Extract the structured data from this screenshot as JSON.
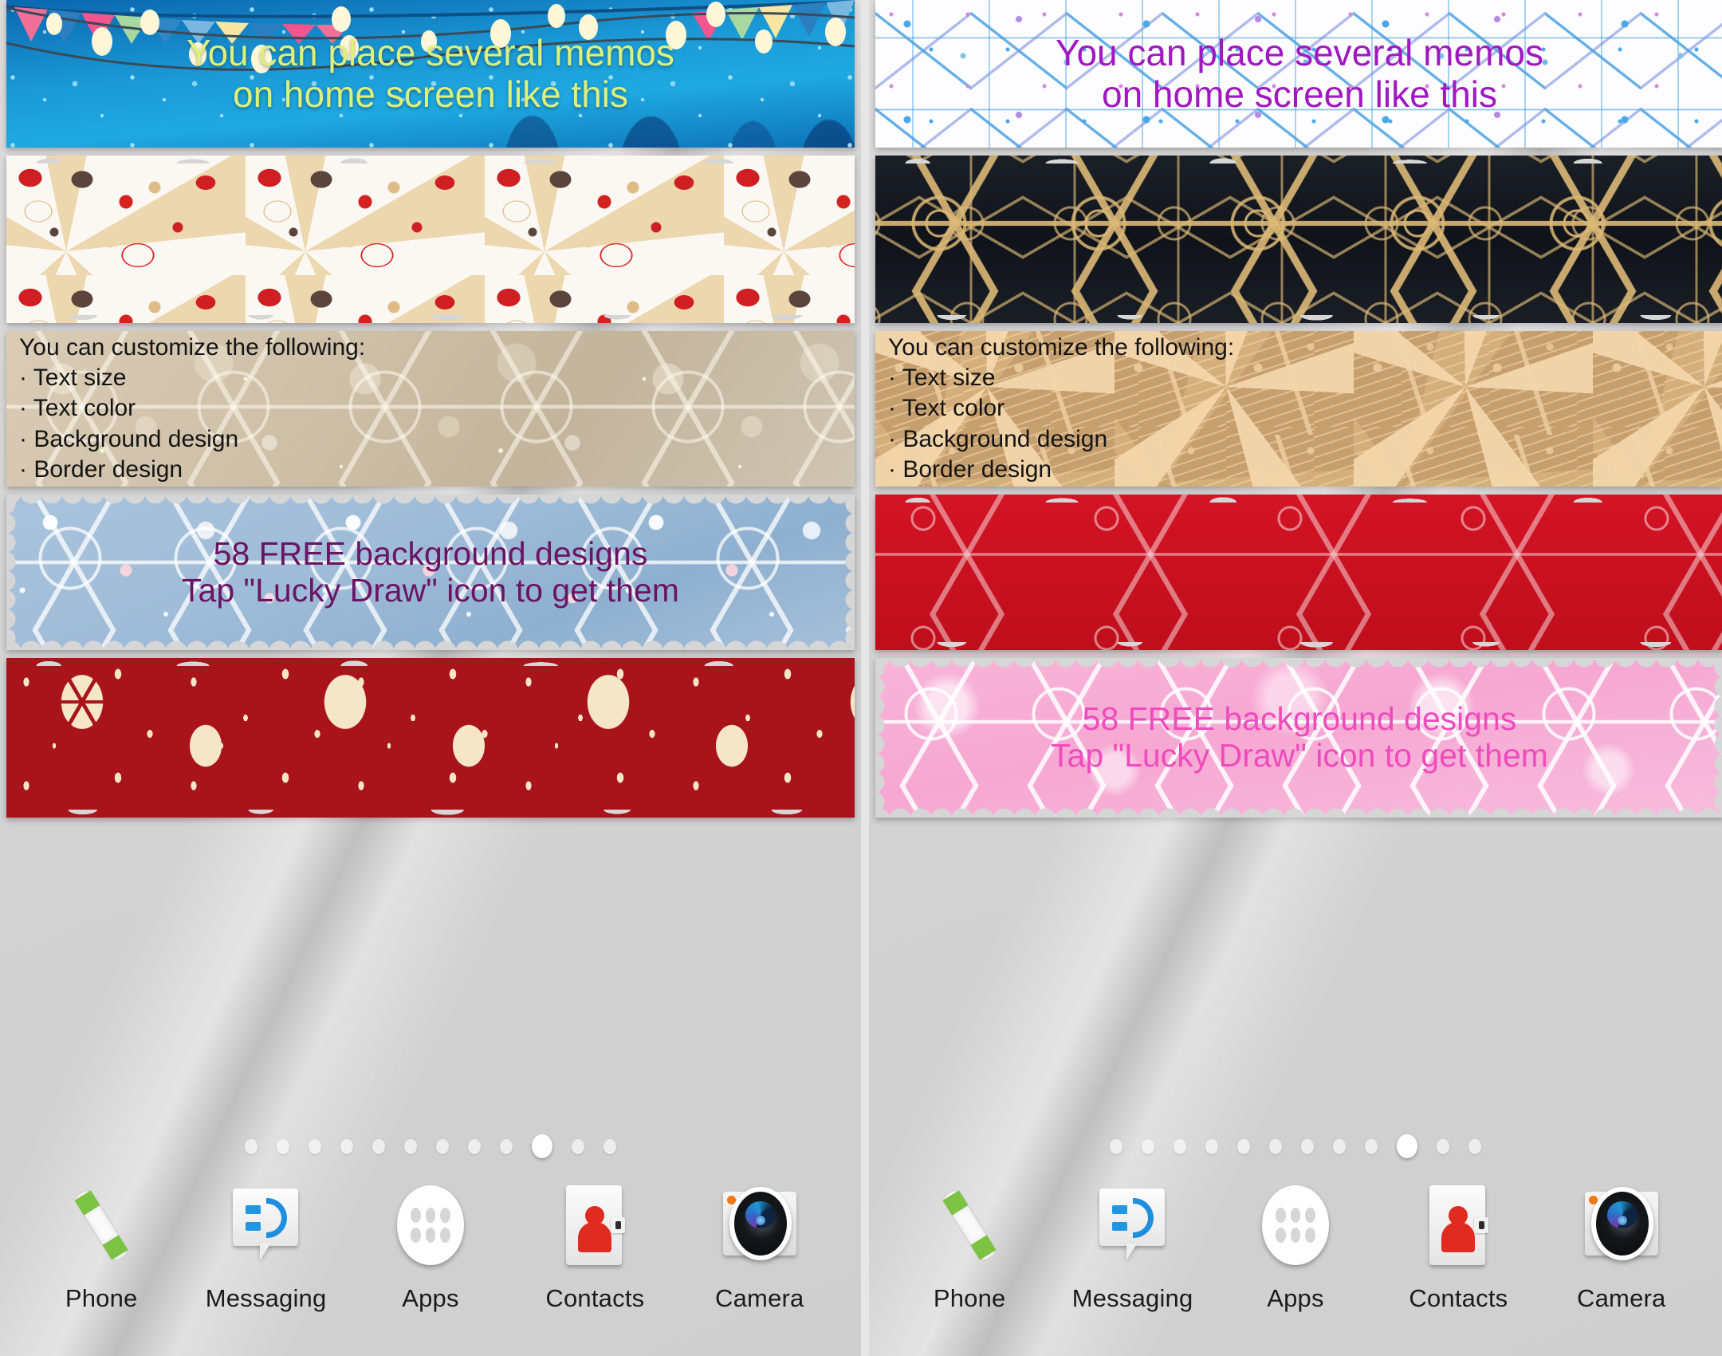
{
  "app": {
    "title": "Christmas Memo Widget Home Screen Preview"
  },
  "panels": [
    {
      "id": "left",
      "memos": [
        {
          "id": "intro",
          "style": "blue-lights",
          "text": "You can place several memos\non home screen like this",
          "text_color": "#ddf07a",
          "align": "center",
          "font_size": "46px"
        },
        {
          "id": "wrapping-paper",
          "style": "christmas-wrapping-paper",
          "text": "",
          "text_color": "",
          "align": "center",
          "font_size": "0px"
        },
        {
          "id": "customize",
          "style": "beige-bokeh-snowflakes",
          "text": "You can customize the following:\n· Text size\n· Text color\n· Background design\n· Border design",
          "text_color": "#141414",
          "align": "left",
          "font_size": "30px"
        },
        {
          "id": "lucky-draw",
          "style": "pale-blue-snow",
          "text": "58 FREE background designs\nTap \"Lucky Draw\" icon to get them",
          "text_color": "#6b1463",
          "align": "center",
          "font_size": "41px"
        },
        {
          "id": "red-medallions",
          "style": "dark-red-medallions",
          "text": "",
          "text_color": "",
          "align": "center",
          "font_size": "0px"
        }
      ],
      "pager": {
        "total": 12,
        "active_index": 9
      },
      "dock": [
        {
          "label": "Phone",
          "icon": "phone-icon"
        },
        {
          "label": "Messaging",
          "icon": "messaging-icon"
        },
        {
          "label": "Apps",
          "icon": "apps-grid-icon"
        },
        {
          "label": "Contacts",
          "icon": "contacts-icon"
        },
        {
          "label": "Camera",
          "icon": "camera-icon"
        }
      ]
    },
    {
      "id": "right",
      "memos": [
        {
          "id": "intro",
          "style": "watercolor-snowflakes",
          "text": "You can place several memos\non home screen like this",
          "text_color": "#a018c0",
          "align": "center",
          "font_size": "46px"
        },
        {
          "id": "gold-black",
          "style": "gold-snowflakes-black",
          "text": "",
          "text_color": "",
          "align": "center",
          "font_size": "0px"
        },
        {
          "id": "customize",
          "style": "tan-stars-sprigs",
          "text": "You can customize the following:\n· Text size\n· Text color\n· Background design\n· Border design",
          "text_color": "#141414",
          "align": "left",
          "font_size": "30px"
        },
        {
          "id": "red-foliage",
          "style": "red-white-foliage",
          "text": "",
          "text_color": "",
          "align": "center",
          "font_size": "0px"
        },
        {
          "id": "lucky-draw",
          "style": "pink-snowflakes",
          "text": "58 FREE background designs\nTap \"Lucky Draw\" icon to get them",
          "text_color": "#ee4bbd",
          "align": "center",
          "font_size": "41px"
        }
      ],
      "pager": {
        "total": 12,
        "active_index": 9
      },
      "dock": [
        {
          "label": "Phone",
          "icon": "phone-icon"
        },
        {
          "label": "Messaging",
          "icon": "messaging-icon"
        },
        {
          "label": "Apps",
          "icon": "apps-grid-icon"
        },
        {
          "label": "Contacts",
          "icon": "contacts-icon"
        },
        {
          "label": "Camera",
          "icon": "camera-icon"
        }
      ]
    }
  ],
  "colors": {
    "wallpaper": "#d6d6d6",
    "accent_green_text": "#ddf07a",
    "accent_purple_text": "#a018c0",
    "accent_magenta_text": "#6b1463",
    "accent_pink_text": "#ee4bbd",
    "dock_label": "#1b1b1b"
  }
}
